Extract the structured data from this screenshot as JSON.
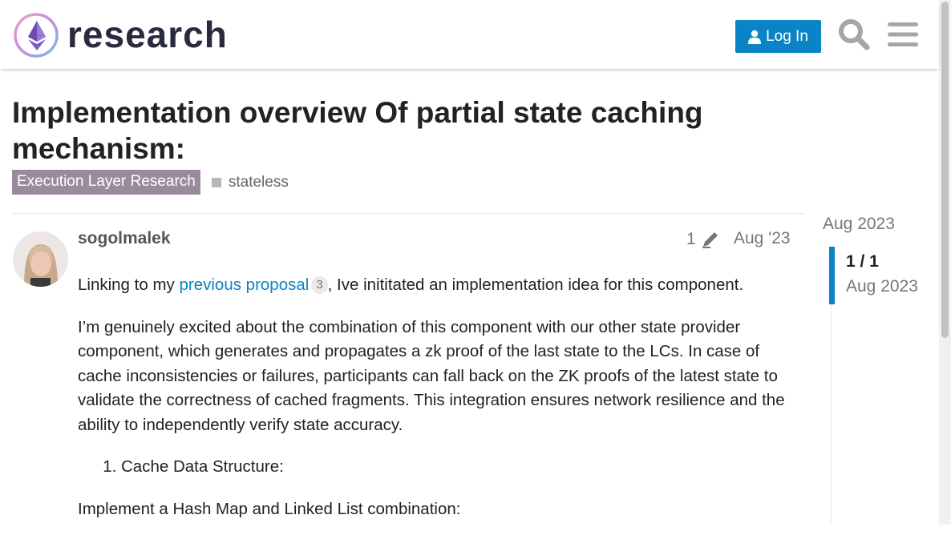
{
  "header": {
    "brand": "research",
    "login_label": "Log In",
    "colors": {
      "accent": "#0a84c6"
    }
  },
  "topic": {
    "title": "Implementation overview Of partial state caching mechanism:",
    "category": "Execution Layer Research",
    "category_color": "#9b8a9d",
    "tags": [
      "stateless"
    ]
  },
  "post": {
    "username": "sogolmalek",
    "edit_count": "1",
    "date": "Aug '23",
    "p1_before": "Linking to my ",
    "p1_link": "previous proposal",
    "p1_link_clicks": "3",
    "p1_after": ", Ive inititated an implementation idea for this component.",
    "p2": "I’m genuinely excited about the combination of this component with our other state provider component, which generates and propagates a zk proof of the last state to the LCs. In case of cache inconsistencies or failures, participants can fall back on the ZK proofs of the latest state to validate the correctness of cached fragments. This integration ensures network resilience and the ability to independently verify state accuracy.",
    "list_item_1": "Cache Data Structure:",
    "p3": "Implement a Hash Map and Linked List combination:"
  },
  "timeline": {
    "top_date": "Aug 2023",
    "count": "1 / 1",
    "bottom_date": "Aug 2023"
  }
}
